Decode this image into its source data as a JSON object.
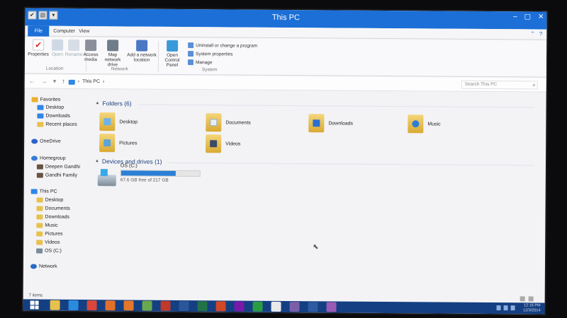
{
  "window": {
    "title": "This PC",
    "controls": [
      "–",
      "▢",
      "✕"
    ]
  },
  "ribbon": {
    "tabs": [
      "File",
      "Computer",
      "View"
    ],
    "buttons": {
      "properties": "Properties",
      "open": "Open",
      "rename": "Rename",
      "access_media": "Access media",
      "map_network_drive": "Map network drive",
      "add_network_location": "Add a network location",
      "open_control_panel": "Open Control Panel",
      "uninstall": "Uninstall or change a program",
      "system_properties": "System properties",
      "manage": "Manage"
    },
    "groups": [
      "Location",
      "Network",
      "System"
    ]
  },
  "address": {
    "path": "This PC",
    "search_placeholder": "Search This PC"
  },
  "navpane": {
    "favorites": {
      "label": "Favorites",
      "items": [
        "Desktop",
        "Downloads",
        "Recent places"
      ]
    },
    "onedrive": "OneDrive",
    "homegroup": {
      "label": "Homegroup",
      "items": [
        "Deepen Gandhi",
        "Gandhi Family"
      ]
    },
    "thispc": {
      "label": "This PC",
      "items": [
        "Desktop",
        "Documents",
        "Downloads",
        "Music",
        "Pictures",
        "Videos",
        "OS (C:)"
      ]
    },
    "network": "Network"
  },
  "content": {
    "folders_header": "Folders (6)",
    "folders": [
      "Desktop",
      "Documents",
      "Downloads",
      "Music",
      "Pictures",
      "Videos"
    ],
    "devices_header": "Devices and drives (1)",
    "drive": {
      "name": "OS (C:)",
      "free_text": "67.6 GB free of 217 GB",
      "used_fraction": 0.69
    }
  },
  "status": {
    "items": "7 items"
  },
  "taskbar": {
    "time": "12:16 PM",
    "date": "12/3/2014",
    "apps": [
      "file-explorer",
      "internet-explorer",
      "chrome",
      "firefox",
      "media-player",
      "picasa",
      "itunes",
      "word",
      "excel",
      "powerpoint",
      "onenote",
      "store",
      "media",
      "games",
      "virtualbox",
      "other"
    ]
  }
}
